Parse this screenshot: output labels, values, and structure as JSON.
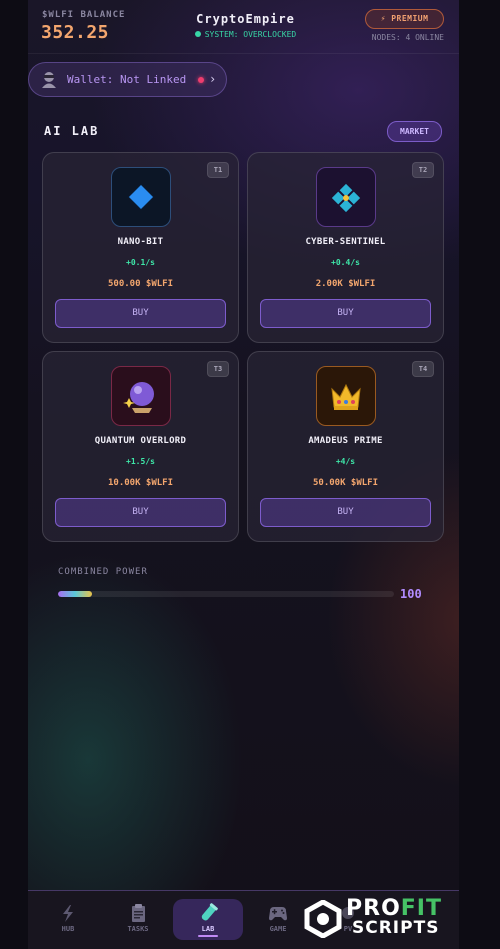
{
  "header": {
    "balance_label": "$WLFI BALANCE",
    "balance_value": "352.25",
    "app_title": "CryptoEmpire",
    "system_status": "SYSTEM: OVERCLOCKED",
    "premium_label": "⚡ PREMIUM",
    "nodes_status": "NODES: 4 ONLINE"
  },
  "wallet": {
    "label": "Wallet: Not Linked",
    "status_color": "#ee3d6e"
  },
  "section": {
    "title": "AI LAB",
    "market_label": "MARKET"
  },
  "cards": [
    {
      "tier": "T1",
      "name": "NANO-BIT",
      "rate": "+0.1/s",
      "price": "500.00 $WLFI",
      "buy_label": "BUY",
      "icon": "blue-diamond-icon"
    },
    {
      "tier": "T2",
      "name": "CYBER-SENTINEL",
      "rate": "+0.4/s",
      "price": "2.00K $WLFI",
      "buy_label": "BUY",
      "icon": "diamond-shape-icon"
    },
    {
      "tier": "T3",
      "name": "QUANTUM OVERLORD",
      "rate": "+1.5/s",
      "price": "10.00K $WLFI",
      "buy_label": "BUY",
      "icon": "crystal-ball-icon"
    },
    {
      "tier": "T4",
      "name": "AMADEUS PRIME",
      "rate": "+4/s",
      "price": "50.00K $WLFI",
      "buy_label": "BUY",
      "icon": "crown-icon"
    }
  ],
  "power": {
    "label": "COMBINED POWER",
    "value": "100",
    "fill_fraction": 0.1
  },
  "nav": [
    {
      "label": "HUB",
      "icon": "lightning-icon"
    },
    {
      "label": "TASKS",
      "icon": "clipboard-icon"
    },
    {
      "label": "LAB",
      "icon": "test-tube-icon",
      "active": true
    },
    {
      "label": "GAME",
      "icon": "gamepad-icon"
    },
    {
      "label": "PV",
      "icon": "partial-icon"
    }
  ],
  "watermark": {
    "line1_a": "PRO",
    "line1_b": "FIT",
    "line2": "SCRIPTS"
  },
  "colors": {
    "accent_orange": "#f3a66e",
    "accent_green": "#3ee6a8",
    "accent_purple": "#7d5ccc"
  }
}
